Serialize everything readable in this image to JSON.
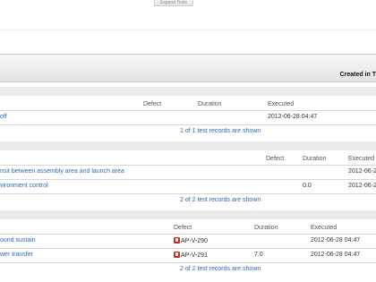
{
  "toolbar": {
    "expand_tools": "Expand Tools"
  },
  "band": {
    "title": "Created in T"
  },
  "groups": [
    {
      "headers": {
        "defect": "Defect",
        "duration": "Duration",
        "executed": "Executed"
      },
      "rows": [
        {
          "name": "off",
          "defect": "",
          "duration": "",
          "executed": "2012-06-28 04:47"
        }
      ],
      "footer": "1 of 1 test records are shown"
    },
    {
      "headers": {
        "defect": "Defect",
        "duration": "Duration",
        "executed": "Executed"
      },
      "rows": [
        {
          "name": "nsit between assembly area and launch area",
          "defect": "",
          "duration": "",
          "executed": "2012-06-2"
        },
        {
          "name": "vironment control",
          "defect": "",
          "duration": "0.0",
          "executed": "2012-06-2"
        }
      ],
      "footer": "2 of 2 test records are shown"
    },
    {
      "headers": {
        "defect": "Defect",
        "duration": "Duration",
        "executed": "Executed"
      },
      "rows": [
        {
          "name": "ound sustain",
          "defect": "AP-V-290",
          "duration": "",
          "executed": "2012-06-28 04:47"
        },
        {
          "name": "wer transfer",
          "defect": "AP-V-291",
          "duration": "7.0",
          "executed": "2012-06-28 04:47"
        }
      ],
      "footer": "2 of 2 test records are shown"
    }
  ]
}
